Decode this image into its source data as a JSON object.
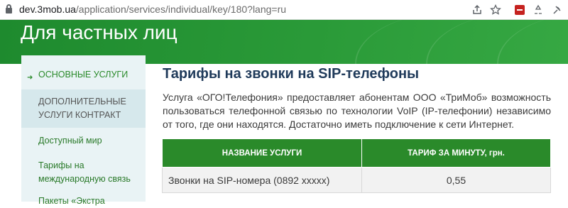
{
  "browser": {
    "url_host": "dev.3mob.ua",
    "url_path": "/application/services/individual/key/180?lang=ru",
    "icons": [
      "lock-icon",
      "share-icon",
      "star-icon",
      "extension-icon",
      "recycle-icon",
      "pin-icon"
    ]
  },
  "header": {
    "title": "Для частных лиц",
    "color": "#2a9a38"
  },
  "sidebar": {
    "main_item": "ОСНОВНЫЕ УСЛУГИ",
    "extra_item": "ДОПОЛНИТЕЛЬНЫЕ УСЛУГИ КОНТРАКТ",
    "sub_items": [
      {
        "label": "Доступный мир"
      },
      {
        "label": "Тарифы на международную связь"
      },
      {
        "label": "Пакеты «Экстра"
      }
    ]
  },
  "content": {
    "title": "Тарифы на звонки на SIP-телефоны",
    "lead": "Услуга «ОГО!Телефония» предоставляет абонентам ООО «ТриМоб» возможность пользоваться телефонной связью по технологии VoIP (IP-телефонии) независимо от того, где они находятся. Достаточно иметь подключение к сети Интернет.",
    "table": {
      "headers": [
        "НАЗВАНИЕ УСЛУГИ",
        "ТАРИФ ЗА МИНУТУ, грн."
      ],
      "rows": [
        [
          "Звонки на SIP-номера (0892 xxxxx)",
          "0,55"
        ]
      ]
    }
  }
}
